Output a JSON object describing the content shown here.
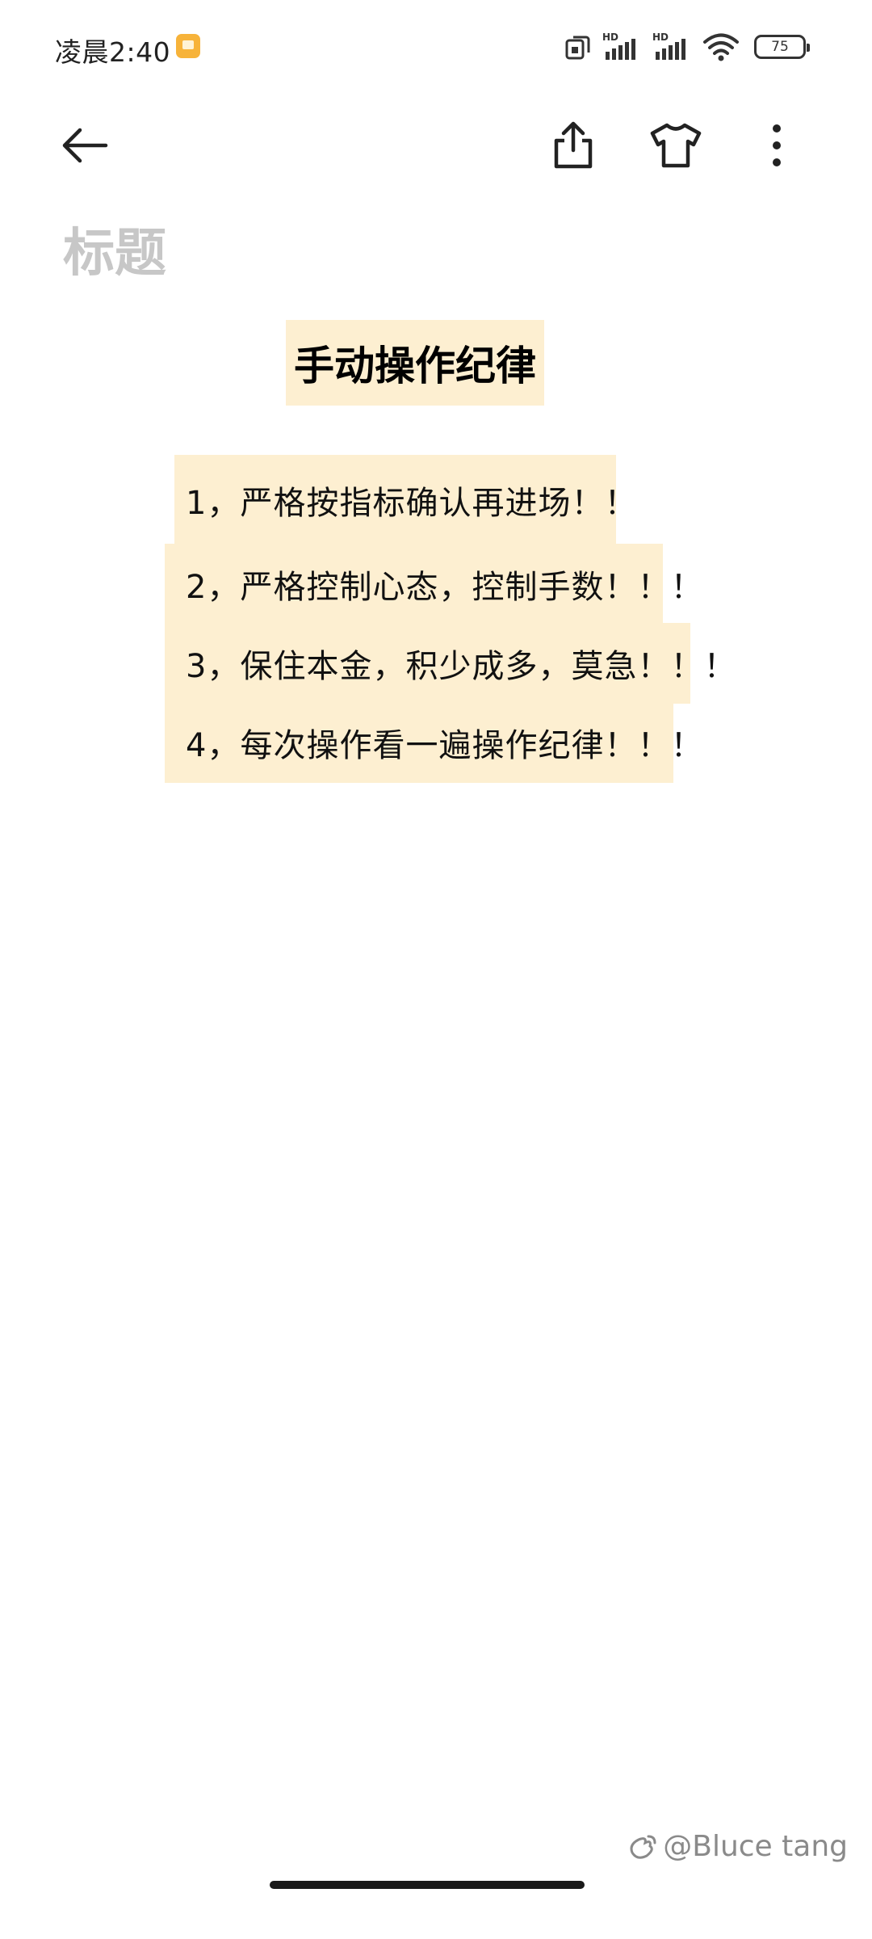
{
  "status_bar": {
    "time": "凌晨2:40",
    "network_1": "HD",
    "network_2": "HD",
    "battery": "75"
  },
  "toolbar": {
    "back": "back-arrow-icon",
    "share": "share-icon",
    "theme": "tshirt-icon",
    "more": "more-vertical-icon"
  },
  "note": {
    "title_placeholder": "标题",
    "heading": "手动操作纪律",
    "lines": [
      "1，严格按指标确认再进场！！",
      "2，严格控制心态，控制手数！！！",
      "3，保住本金，积少成多，莫急！！！",
      "4，每次操作看一遍操作纪律！！！"
    ],
    "highlight_color": "#fdefd1"
  },
  "watermark": "@Bluce tang"
}
